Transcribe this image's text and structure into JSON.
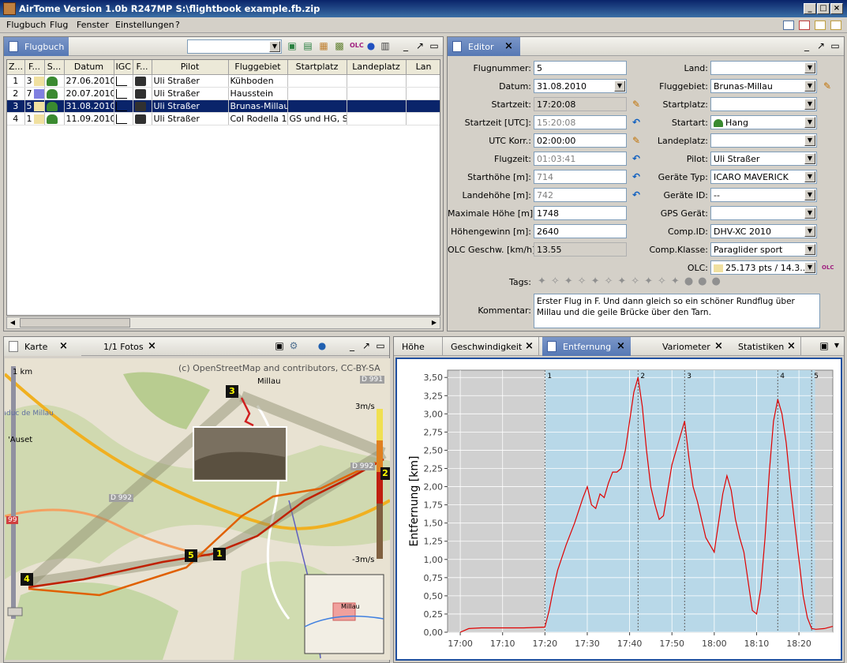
{
  "window": {
    "title": "AirTome Version 1.0b R247MP   S:\\flightbook example.fb.zip"
  },
  "menu": [
    "Flugbuch",
    "Flug",
    "Fenster",
    "Einstellungen",
    "?"
  ],
  "flugbuch": {
    "tab": "Flugbuch",
    "columns": [
      "Z...",
      "F...",
      "S...",
      "Datum",
      "IGC",
      "F...",
      "Pilot",
      "Fluggebiet",
      "Startplatz",
      "Landeplatz",
      "Lan"
    ],
    "rows": [
      {
        "z": "1",
        "f": "3",
        "datum": "27.06.2010",
        "pilot": "Uli Straßer",
        "gebiet": "Kühboden",
        "start": "",
        "lande": ""
      },
      {
        "z": "2",
        "f": "7",
        "datum": "20.07.2010",
        "pilot": "Uli Straßer",
        "gebiet": "Hausstein",
        "start": "",
        "lande": ""
      },
      {
        "z": "3",
        "f": "5",
        "datum": "31.08.2010",
        "pilot": "Uli Straßer",
        "gebiet": "Brunas-Millau",
        "start": "",
        "lande": ""
      },
      {
        "z": "4",
        "f": "1",
        "datum": "11.09.2010",
        "pilot": "Uli Straßer",
        "gebiet": "Col Rodella  1",
        "start": "GS und HG, SO",
        "lande": ""
      }
    ],
    "selected_row": 2
  },
  "editor": {
    "tab": "Editor",
    "left": [
      {
        "label": "Flugnummer:",
        "value": "5"
      },
      {
        "label": "Datum:",
        "value": "31.08.2010"
      },
      {
        "label": "Startzeit:",
        "value": "17:20:08"
      },
      {
        "label": "Startzeit [UTC]:",
        "value": "15:20:08"
      },
      {
        "label": "UTC Korr.:",
        "value": "02:00:00"
      },
      {
        "label": "Flugzeit:",
        "value": "01:03:41"
      },
      {
        "label": "Starthöhe [m]:",
        "value": "714"
      },
      {
        "label": "Landehöhe [m]:",
        "value": "742"
      },
      {
        "label": "Maximale Höhe [m]:",
        "value": "1748"
      },
      {
        "label": "Höhengewinn [m]:",
        "value": "2640"
      },
      {
        "label": "OLC Geschw. [km/h]:",
        "value": "13.55"
      }
    ],
    "right": [
      {
        "label": "Land:",
        "value": ""
      },
      {
        "label": "Fluggebiet:",
        "value": "Brunas-Millau"
      },
      {
        "label": "Startplatz:",
        "value": ""
      },
      {
        "label": "Startart:",
        "value": "Hang"
      },
      {
        "label": "Landeplatz:",
        "value": ""
      },
      {
        "label": "Pilot:",
        "value": "Uli Straßer"
      },
      {
        "label": "Geräte Typ:",
        "value": "ICARO MAVERICK"
      },
      {
        "label": "Geräte ID:",
        "value": "--"
      },
      {
        "label": "GPS Gerät:",
        "value": ""
      },
      {
        "label": "Comp.ID:",
        "value": "DHV-XC 2010"
      },
      {
        "label": "Comp.Klasse:",
        "value": "Paraglider sport"
      },
      {
        "label": "OLC:",
        "value": "25.173 pts / 14.3..."
      }
    ],
    "tags_label": "Tags:",
    "kommentar_label": "Kommentar:",
    "kommentar": "Erster Flug in F. Und dann gleich so ein schöner Rundflug über Millau und die geile Brücke über den Tarn."
  },
  "karte": {
    "tabs": [
      "Karte",
      "1/1 Fotos"
    ],
    "copyright": "(c) OpenStreetMap and contributors, CC-BY-SA",
    "scale": "1 km",
    "vario_top": "3m/s",
    "vario_bottom": "-3m/s",
    "place_labels": [
      "Millau",
      "'Auset",
      "iaduc de Millau",
      "D 991",
      "D 992",
      "D 992",
      "99"
    ],
    "markers": [
      "3",
      "2",
      "1",
      "4",
      "5"
    ],
    "overview_label": "Millau"
  },
  "charts_tabs": [
    "Höhe",
    "Geschwindigkeit",
    "Entfernung",
    "Variometer",
    "Statistiken"
  ],
  "chart_data": {
    "type": "line",
    "ylabel": "Entfernung [km]",
    "xlabel": "",
    "yticks": [
      "0,00",
      "0,25",
      "0,50",
      "0,75",
      "1,00",
      "1,25",
      "1,50",
      "1,75",
      "2,00",
      "2,25",
      "2,50",
      "2,75",
      "3,00",
      "3,25",
      "3,50"
    ],
    "xticks": [
      "17:00",
      "17:10",
      "17:20",
      "17:30",
      "17:40",
      "17:50",
      "18:00",
      "18:10",
      "18:20"
    ],
    "ylim": [
      0,
      3.6
    ],
    "xlim": [
      "16:60",
      "18:28"
    ],
    "active_range": [
      "17:20:08",
      "18:23:49"
    ],
    "waypoints": [
      {
        "label": "1",
        "t": "17:20"
      },
      {
        "label": "2",
        "t": "17:42"
      },
      {
        "label": "3",
        "t": "17:53"
      },
      {
        "label": "4",
        "t": "18:15"
      },
      {
        "label": "5",
        "t": "18:23"
      }
    ],
    "series": [
      {
        "values": [
          [
            "17:00",
            0.0
          ],
          [
            "17:02",
            0.05
          ],
          [
            "17:05",
            0.06
          ],
          [
            "17:10",
            0.06
          ],
          [
            "17:15",
            0.06
          ],
          [
            "17:20",
            0.07
          ],
          [
            "17:21",
            0.3
          ],
          [
            "17:22",
            0.6
          ],
          [
            "17:23",
            0.85
          ],
          [
            "17:25",
            1.2
          ],
          [
            "17:27",
            1.5
          ],
          [
            "17:29",
            1.85
          ],
          [
            "17:30",
            2.0
          ],
          [
            "17:31",
            1.75
          ],
          [
            "17:32",
            1.7
          ],
          [
            "17:33",
            1.9
          ],
          [
            "17:34",
            1.85
          ],
          [
            "17:35",
            2.05
          ],
          [
            "17:36",
            2.2
          ],
          [
            "17:37",
            2.2
          ],
          [
            "17:38",
            2.25
          ],
          [
            "17:39",
            2.5
          ],
          [
            "17:40",
            2.9
          ],
          [
            "17:41",
            3.3
          ],
          [
            "17:42",
            3.5
          ],
          [
            "17:43",
            3.1
          ],
          [
            "17:44",
            2.5
          ],
          [
            "17:45",
            2.0
          ],
          [
            "17:46",
            1.75
          ],
          [
            "17:47",
            1.55
          ],
          [
            "17:48",
            1.6
          ],
          [
            "17:50",
            2.3
          ],
          [
            "17:52",
            2.7
          ],
          [
            "17:53",
            2.9
          ],
          [
            "17:54",
            2.4
          ],
          [
            "17:55",
            2.0
          ],
          [
            "17:56",
            1.8
          ],
          [
            "17:58",
            1.3
          ],
          [
            "18:00",
            1.1
          ],
          [
            "18:01",
            1.5
          ],
          [
            "18:02",
            1.9
          ],
          [
            "18:03",
            2.15
          ],
          [
            "18:04",
            1.95
          ],
          [
            "18:05",
            1.55
          ],
          [
            "18:06",
            1.3
          ],
          [
            "18:07",
            1.1
          ],
          [
            "18:08",
            0.7
          ],
          [
            "18:09",
            0.3
          ],
          [
            "18:10",
            0.25
          ],
          [
            "18:11",
            0.6
          ],
          [
            "18:12",
            1.3
          ],
          [
            "18:13",
            2.2
          ],
          [
            "18:14",
            2.9
          ],
          [
            "18:15",
            3.2
          ],
          [
            "18:16",
            3.0
          ],
          [
            "18:17",
            2.6
          ],
          [
            "18:18",
            2.0
          ],
          [
            "18:19",
            1.5
          ],
          [
            "18:20",
            1.0
          ],
          [
            "18:21",
            0.5
          ],
          [
            "18:22",
            0.2
          ],
          [
            "18:23",
            0.05
          ],
          [
            "18:24",
            0.04
          ],
          [
            "18:26",
            0.05
          ],
          [
            "18:28",
            0.08
          ]
        ]
      }
    ]
  }
}
